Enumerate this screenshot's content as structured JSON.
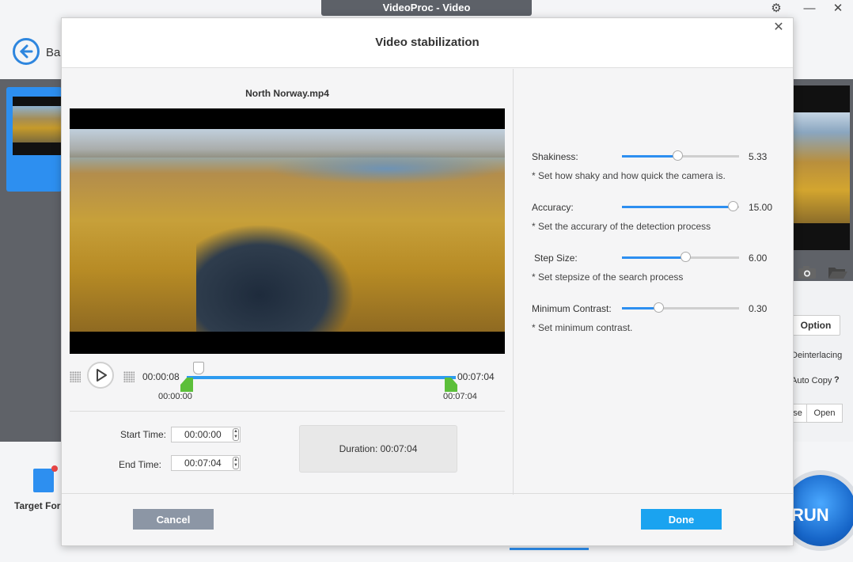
{
  "app": {
    "window_title": "VideoProc - Video",
    "back_label": "Ba",
    "target_format_label": "Target For",
    "right_panel": {
      "option_label": "Option",
      "deinterlacing_label": "Deinterlacing",
      "auto_copy_label": "Auto Copy",
      "help_mark": "?",
      "browse_label_partial": "se",
      "open_label": "Open"
    },
    "run_label": "RUN"
  },
  "dialog": {
    "title": "Video stabilization",
    "close_glyph": "✕",
    "file_name": "North Norway.mp4",
    "playback": {
      "current_time": "00:00:08",
      "end_time_top": "00:07:04",
      "trim_start_label": "00:00:00",
      "trim_end_label": "00:07:04",
      "progress_fraction": 0.02
    },
    "start_time": {
      "label": "Start Time:",
      "value": "00:00:00"
    },
    "end_time": {
      "label": "End Time:",
      "value": "00:07:04"
    },
    "duration_text": "Duration:  00:07:04",
    "parameters": [
      {
        "label": "Shakiness:",
        "value": "5.33",
        "fraction": 0.48,
        "description": "* Set how shaky and how quick the camera is."
      },
      {
        "label": "Accuracy:",
        "value": "15.00",
        "fraction": 0.95,
        "description": "* Set the accurary of the detection process"
      },
      {
        "label": "Step Size:",
        "value": "6.00",
        "fraction": 0.55,
        "description": "* Set stepsize of the search process"
      },
      {
        "label": "Minimum Contrast:",
        "value": "0.30",
        "fraction": 0.32,
        "description": "* Set minimum contrast."
      }
    ],
    "cancel_label": "Cancel",
    "done_label": "Done"
  },
  "colors": {
    "accent": "#2d8ff0",
    "done_button": "#1aa3f0",
    "cancel_button": "#8c96a5",
    "trim_handle": "#5cbf3a"
  }
}
